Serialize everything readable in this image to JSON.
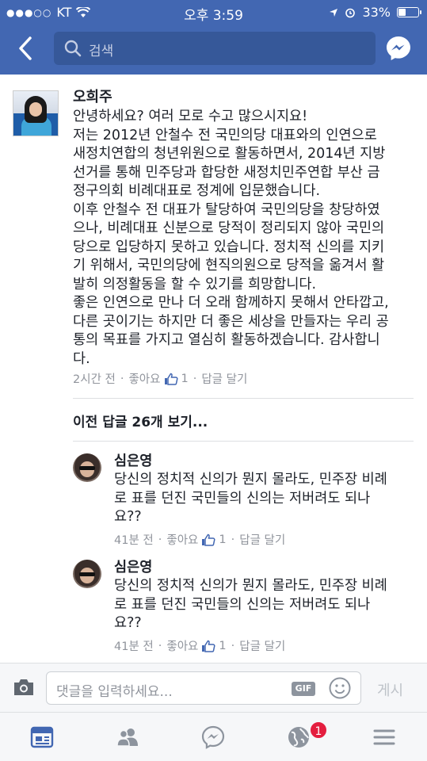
{
  "status_bar": {
    "carrier": "KT",
    "time": "오후 3:59",
    "battery": "33%",
    "battery_level": 0.33
  },
  "nav": {
    "search_placeholder": "검색",
    "icons": [
      "back-arrow-icon",
      "search-icon",
      "messenger-icon"
    ]
  },
  "post": {
    "author": "오희주",
    "text": "안녕하세요? 여러 모로 수고 많으시지요!\n저는 2012년 안철수 전 국민의당 대표와의 인연으로\n새정치연합의 청년위원으로 활동하면서, 2014년 지방\n선거를 통해 민주당과 합당한 새정치민주연합 부산 금\n정구의회 비례대표로 정계에 입문했습니다.\n이후 안철수 전 대표가 탈당하여 국민의당을 창당하였\n으나, 비례대표 신분으로 당적이 정리되지 않아 국민의\n당으로 입당하지 못하고 있습니다. 정치적 신의를 지키\n기 위해서, 국민의당에 현직의원으로 당적을 옮겨서 활\n발히 의정활동을 할 수 있기를 희망합니다.\n좋은 인연으로 만나 더 오래 함께하지 못해서 안타깝고,\n다른 곳이기는 하지만 더 좋은 세상을 만들자는 우리 공\n통의 목표를 가지고 열심히 활동하겠습니다. 감사합니\n다.",
    "time": "2시간 전",
    "like_label": "좋아요",
    "like_count": "1",
    "reply_label": "답글 달기",
    "view_previous": "이전 답글 26개 보기..."
  },
  "replies": [
    {
      "author": "심은영",
      "text": "당신의 정치적 신의가 뭔지 몰라도, 민주장 비례\n로 표를 던진 국민들의 신의는 저버려도 되나\n요??",
      "time": "41분 전",
      "like_label": "좋아요",
      "like_count": "1",
      "reply_label": "답글 달기"
    },
    {
      "author": "심은영",
      "text": "당신의 정치적 신의가 뭔지 몰라도, 민주장 비례\n로 표를 던진 국민들의 신의는 저버려도 되나\n요??",
      "time": "41분 전",
      "like_label": "좋아요",
      "like_count": "1",
      "reply_label": "답글 달기"
    }
  ],
  "comment_bar": {
    "placeholder": "댓글을 입력하세요...",
    "gif_label": "GIF",
    "post_label": "게시"
  },
  "tab_bar": {
    "tabs": [
      "news-feed-icon",
      "friends-icon",
      "messenger-icon",
      "notifications-globe-icon",
      "menu-icon"
    ],
    "notification_count": "1"
  },
  "colors": {
    "header": "#4267b2",
    "search_bg": "#365899",
    "text": "#1d2129",
    "meta": "#90949c",
    "active_tab": "#4267b2",
    "badge": "#e41e3f"
  }
}
